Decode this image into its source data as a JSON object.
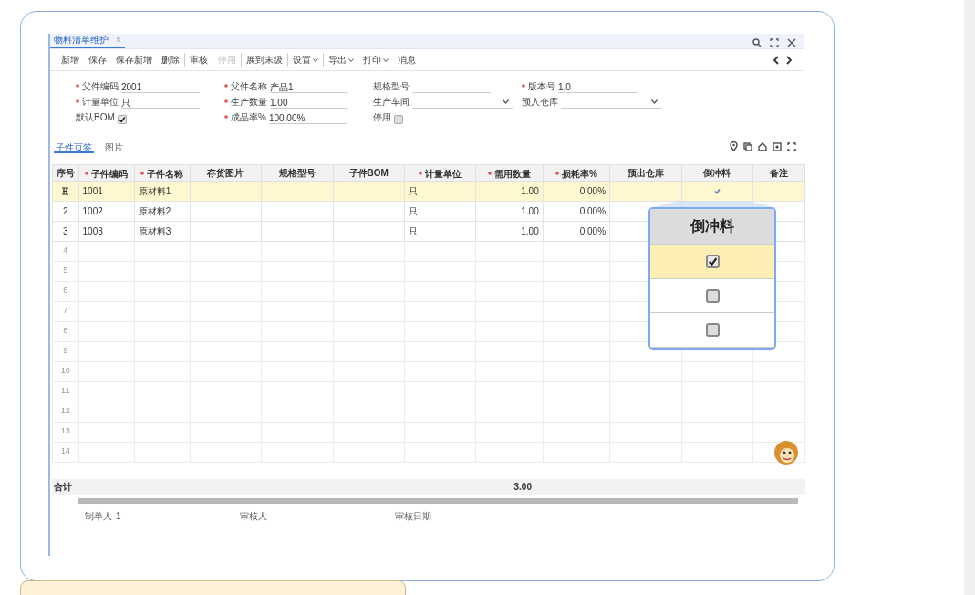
{
  "tab": {
    "title": "物料清单维护",
    "close": "×",
    "selected": true
  },
  "toolbar": [
    [
      {
        "label": "新增",
        "disabled": false,
        "dropdown": false
      },
      {
        "label": "保存",
        "disabled": false,
        "dropdown": false
      },
      {
        "label": "保存新增",
        "disabled": false,
        "dropdown": false
      },
      {
        "label": "删除",
        "disabled": false,
        "dropdown": false
      }
    ],
    [
      {
        "label": "审核",
        "disabled": false,
        "dropdown": false
      }
    ],
    [
      {
        "label": "停用",
        "disabled": true,
        "dropdown": false
      }
    ],
    [
      {
        "label": "展到末级",
        "disabled": false,
        "dropdown": false
      }
    ],
    [
      {
        "label": "设置",
        "disabled": false,
        "dropdown": true
      }
    ],
    [
      {
        "label": "导出",
        "disabled": false,
        "dropdown": true
      },
      {
        "label": "打印",
        "disabled": false,
        "dropdown": true
      },
      {
        "label": "消息",
        "disabled": false,
        "dropdown": false
      }
    ]
  ],
  "form": [
    [
      {
        "kind": "text",
        "label": "父件编码",
        "required": true,
        "value": "2001"
      },
      {
        "kind": "text",
        "label": "父件名称",
        "required": true,
        "value": "产品1"
      },
      {
        "kind": "text",
        "label": "规格型号",
        "required": false
      },
      {
        "kind": "text",
        "label": "版本号",
        "required": true,
        "value": "1.0"
      }
    ],
    [
      {
        "kind": "text",
        "label": "计量单位",
        "required": true,
        "value": "只"
      },
      {
        "kind": "text",
        "label": "生产数量",
        "required": true,
        "value": "1.00"
      },
      {
        "kind": "select",
        "label": "生产车间",
        "required": false
      },
      {
        "kind": "select",
        "label": "预入仓库",
        "required": false
      }
    ],
    [
      {
        "kind": "checkbox",
        "label": "默认BOM",
        "required": false,
        "checked": true
      },
      {
        "kind": "text",
        "label": "成品率%",
        "required": true,
        "value": "100.00%"
      },
      {
        "kind": "checkbox",
        "label": "停用",
        "required": false,
        "checked": false
      }
    ]
  ],
  "subtabs": [
    {
      "label": "子件页签",
      "selected": true
    },
    {
      "label": "图片",
      "selected": false
    }
  ],
  "table": {
    "columns": [
      {
        "label": "序号",
        "required": false
      },
      {
        "label": "子件编码",
        "required": true
      },
      {
        "label": "子件名称",
        "required": true
      },
      {
        "label": "存货图片",
        "required": false
      },
      {
        "label": "规格型号",
        "required": false
      },
      {
        "label": "子件BOM",
        "required": false
      },
      {
        "label": "计量单位",
        "required": true
      },
      {
        "label": "需用数量",
        "required": true
      },
      {
        "label": "损耗率%",
        "required": true
      },
      {
        "label": "预出仓库",
        "required": false
      },
      {
        "label": "倒冲料",
        "required": false
      },
      {
        "label": "备注",
        "required": false
      }
    ],
    "rows": [
      {
        "selected": true,
        "code": "1001",
        "name": "原材料1",
        "unit": "只",
        "qty": "1.00",
        "loss": "0.00%",
        "backflush": true
      },
      {
        "selected": false,
        "no": "2",
        "code": "1002",
        "name": "原材料2",
        "unit": "只",
        "qty": "1.00",
        "loss": "0.00%",
        "backflush": false
      },
      {
        "selected": false,
        "no": "3",
        "code": "1003",
        "name": "原材料3",
        "unit": "只",
        "qty": "1.00",
        "loss": "0.00%",
        "backflush": false
      }
    ],
    "empty_rows": [
      "4",
      "5",
      "6",
      "7",
      "8",
      "9",
      "10",
      "11",
      "12",
      "13",
      "14"
    ],
    "total_label": "合计",
    "total_qty": "3.00"
  },
  "footer": [
    {
      "label": "制单人",
      "value": "1"
    },
    {
      "label": "审核人"
    },
    {
      "label": "审核日期"
    }
  ],
  "callout": {
    "title": "倒冲料"
  }
}
